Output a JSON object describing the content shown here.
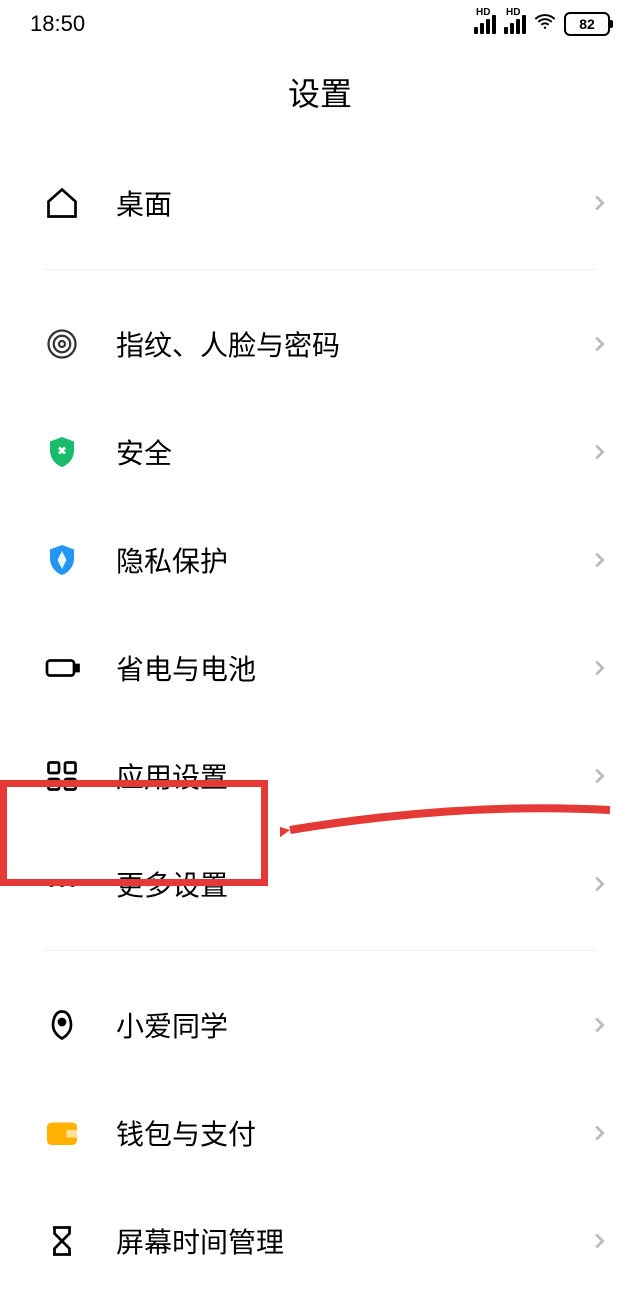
{
  "status": {
    "time": "18:50",
    "battery": "82"
  },
  "header": {
    "title": "设置"
  },
  "items": {
    "desktop": "桌面",
    "biometric": "指纹、人脸与密码",
    "security": "安全",
    "privacy": "隐私保护",
    "battery": "省电与电池",
    "apps": "应用设置",
    "more": "更多设置",
    "ai": "小爱同学",
    "wallet": "钱包与支付",
    "screentime": "屏幕时间管理"
  }
}
